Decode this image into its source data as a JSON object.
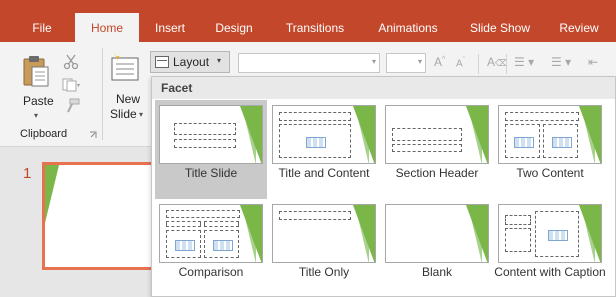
{
  "ribbon": {
    "tabs": [
      {
        "label": "File",
        "active": false
      },
      {
        "label": "Home",
        "active": true
      },
      {
        "label": "Insert",
        "active": false
      },
      {
        "label": "Design",
        "active": false
      },
      {
        "label": "Transitions",
        "active": false
      },
      {
        "label": "Animations",
        "active": false
      },
      {
        "label": "Slide Show",
        "active": false
      },
      {
        "label": "Review",
        "active": false
      }
    ],
    "clipboard": {
      "paste_label": "Paste",
      "group_label": "Clipboard"
    },
    "slides": {
      "new_slide_label_line1": "New",
      "new_slide_label_line2": "Slide",
      "layout_label": "Layout"
    }
  },
  "icons": {
    "paste": "paste-icon",
    "cut": "scissors-icon",
    "copy": "copy-icon",
    "format_painter": "format-painter-icon",
    "new_slide": "new-slide-icon",
    "layout": "layout-icon"
  },
  "gallery": {
    "theme_name": "Facet",
    "layouts": [
      {
        "name": "Title Slide",
        "selected": true
      },
      {
        "name": "Title and Content",
        "selected": false
      },
      {
        "name": "Section Header",
        "selected": false
      },
      {
        "name": "Two Content",
        "selected": false
      },
      {
        "name": "Comparison",
        "selected": false
      },
      {
        "name": "Title Only",
        "selected": false
      },
      {
        "name": "Blank",
        "selected": false
      },
      {
        "name": "Content with Caption",
        "selected": false
      }
    ]
  },
  "slide_pane": {
    "slide_number": "1"
  },
  "colors": {
    "accent": "#c3472b",
    "theme_green": "#7ab648",
    "selected_slide_border": "#e8714f"
  }
}
